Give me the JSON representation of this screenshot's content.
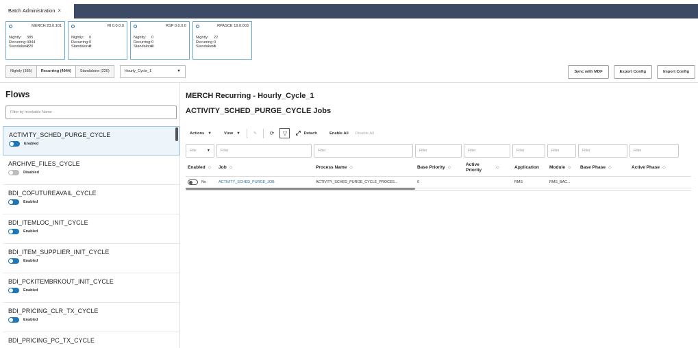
{
  "window": {
    "tab_title": "Batch Administration",
    "close_glyph": "×"
  },
  "apps": [
    {
      "name": "MERCH 23.0.101",
      "nightly_label": "Nightly:",
      "nightly": "385",
      "recurring_label": "Recurring:",
      "recurring": "4944",
      "standalone_label": "Standalone:",
      "standalone": "220"
    },
    {
      "name": "RI 0.0.0.0",
      "nightly_label": "Nightly:",
      "nightly": "0",
      "recurring_label": "Recurring:",
      "recurring": "0",
      "standalone_label": "Standalone:",
      "standalone": "0"
    },
    {
      "name": "RSP 0.0.0.0",
      "nightly_label": "Nightly:",
      "nightly": "0",
      "recurring_label": "Recurring:",
      "recurring": "0",
      "standalone_label": "Standalone:",
      "standalone": "0"
    },
    {
      "name": "RPASCE 19.0.003",
      "nightly_label": "Nightly:",
      "nightly": "22",
      "recurring_label": "Recurring:",
      "recurring": "0",
      "standalone_label": "Standalone:",
      "standalone": "5"
    }
  ],
  "batch_types": {
    "nightly": "Nightly (385)",
    "recurring": "Recurring (4944)",
    "standalone": "Standalone (220)"
  },
  "cycle_select": {
    "value": "Hourly_Cycle_1",
    "arrow": "▼"
  },
  "actions": {
    "sync": "Sync with MDF",
    "export": "Export Config",
    "import": "Import Config"
  },
  "flows": {
    "title": "Flows",
    "filter_placeholder": "Filter by Invokable Name",
    "items": [
      {
        "name": "ACTIVITY_SCHED_PURGE_CYCLE",
        "status": "Enabled"
      },
      {
        "name": "ARCHIVE_FILES_CYCLE",
        "status": "Disabled"
      },
      {
        "name": "BDI_COFUTUREAVAIL_CYCLE",
        "status": "Enabled"
      },
      {
        "name": "BDI_ITEMLOC_INIT_CYCLE",
        "status": "Enabled"
      },
      {
        "name": "BDI_ITEM_SUPPLIER_INIT_CYCLE",
        "status": "Enabled"
      },
      {
        "name": "BDI_PCKITEMBRKOUT_INIT_CYCLE",
        "status": "Enabled"
      },
      {
        "name": "BDI_PRICING_CLR_TX_CYCLE",
        "status": "Enabled"
      },
      {
        "name": "BDI_PRICING_PC_TX_CYCLE",
        "status": ""
      }
    ]
  },
  "main": {
    "title": "MERCH Recurring - Hourly_Cycle_1",
    "subtitle": "ACTIVITY_SCHED_PURGE_CYCLE Jobs"
  },
  "toolbar": {
    "actions": "Actions",
    "view": "View",
    "caret": "▼",
    "edit_glyph": "✎",
    "refresh_glyph": "⟳",
    "filter_glyph": "▽",
    "detach_glyph": "⤢",
    "detach": "Detach",
    "enable_all": "Enable All",
    "disable_all": "Disable All"
  },
  "table": {
    "filter_placeholder": "Filter",
    "first_filter": "Filte",
    "sort_glyph": "◇",
    "columns": [
      "Enabled",
      "Job",
      "Process Name",
      "Base Priority",
      "Active Priority",
      "Application",
      "Module",
      "Base Phase",
      "Active Phase"
    ],
    "rows": [
      {
        "enabled": "No",
        "job": "ACTIVITY_SCHED_PURGE_JOB",
        "process": "ACTIVITY_SCHED_PURGE_CYCLE_PROCES...",
        "base_priority": "0",
        "active_priority": "",
        "application": "RMS",
        "module": "RMS_BAC...",
        "base_phase": "",
        "active_phase": ""
      }
    ]
  }
}
